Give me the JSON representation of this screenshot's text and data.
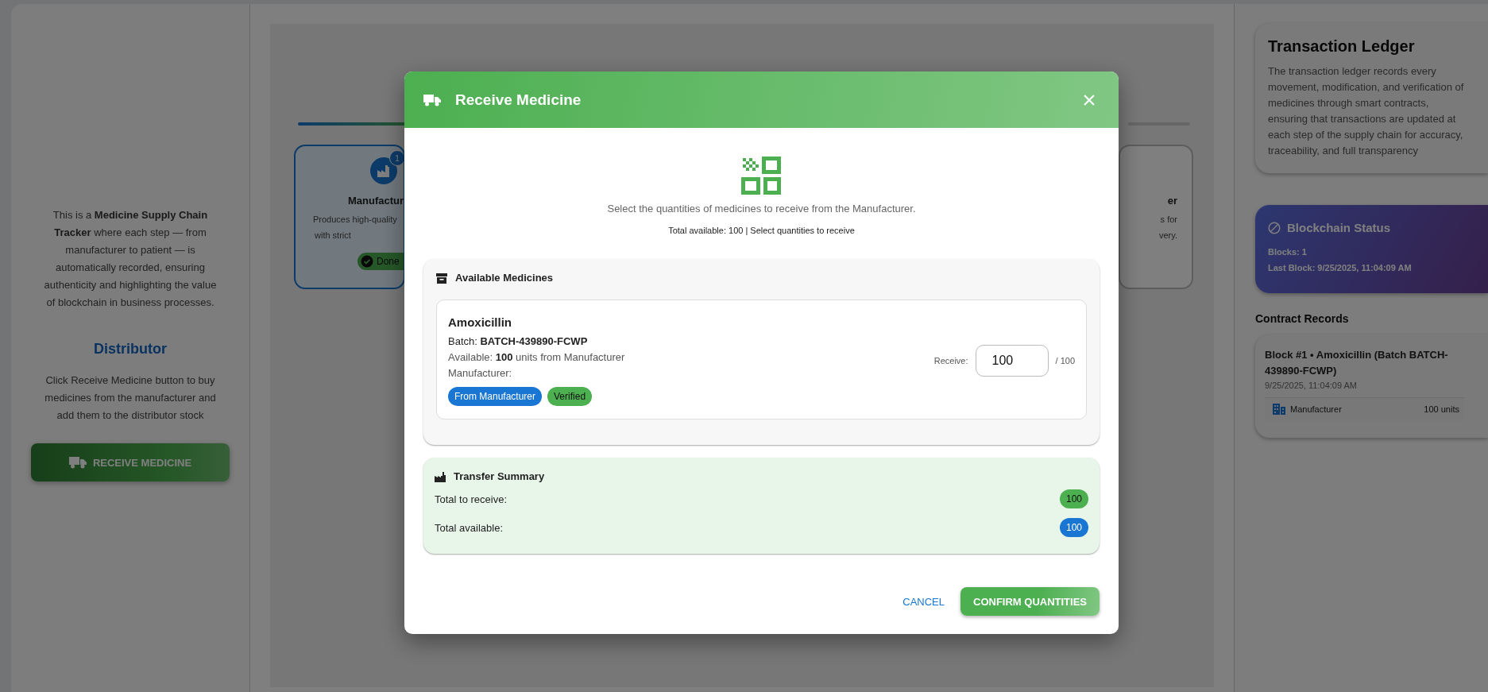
{
  "left_panel": {
    "intro": "This is a **Medicine Supply Chain Tracker** where each step — from manufacturer to patient — is automatically recorded, ensuring authenticity and highlighting the value of blockchain in business processes.",
    "role_title": "Distributor",
    "role_description": "Click Receive Medicine button to buy medicines from the manufacturer and add them to the distributor stock",
    "action_button": "RECEIVE MEDICINE"
  },
  "supply_chain": {
    "steps": [
      {
        "badge": "1",
        "title": "Manufactur",
        "description_lines": [
          "Produces high-quality",
          "with strict"
        ],
        "status": "Done",
        "completed": true
      },
      {
        "title": "er",
        "description_lines": [
          "s for",
          "very."
        ],
        "completed": false
      }
    ]
  },
  "modal": {
    "title": "Receive Medicine",
    "instruction": "Select the quantities of medicines to receive from the Manufacturer.",
    "summary_line": "Total available: 100 | Select quantities to receive",
    "medicines_section": {
      "title": "Available Medicines",
      "items": [
        {
          "name": "Amoxicillin",
          "batch": "Batch: **BATCH-439890-FCWP**",
          "available": "Available: **100** units from Manufacturer",
          "manufacturer": "Manufacturer:",
          "tags": [
            {
              "label": "From Manufacturer",
              "color": "#1976d2"
            },
            {
              "label": "Verified",
              "color": "#4caf50"
            }
          ],
          "receive_label": "Receive:",
          "quantity": "100",
          "max": "/ 100"
        }
      ]
    },
    "transfer_summary": {
      "title": "Transfer Summary",
      "rows": [
        {
          "label": "Total to receive:",
          "value": "100",
          "color": "#4caf50"
        },
        {
          "label": "Total available:",
          "value": "100",
          "color": "#1976d2"
        }
      ]
    },
    "buttons": {
      "cancel": "CANCEL",
      "confirm": "CONFIRM QUANTITIES"
    }
  },
  "right_panel": {
    "ledger": {
      "title": "Transaction Ledger",
      "description": "The transaction ledger records every movement, modification, and verification of medicines through smart contracts, ensuring that transactions are updated at each step of the supply chain for accuracy, traceability, and full transparency"
    },
    "blockchain_status": {
      "title": "Blockchain Status",
      "blocks": "Blocks: 1",
      "last_block": "Last Block: 9/25/2025, 11:04:09 AM"
    },
    "contract_records": {
      "title": "Contract Records",
      "records": [
        {
          "title": "Block #1 • Amoxicillin (Batch BATCH-439890-FCWP)",
          "time": "9/25/2025, 11:04:09 AM",
          "party": "Manufacturer",
          "amount": "100 units"
        }
      ]
    }
  }
}
